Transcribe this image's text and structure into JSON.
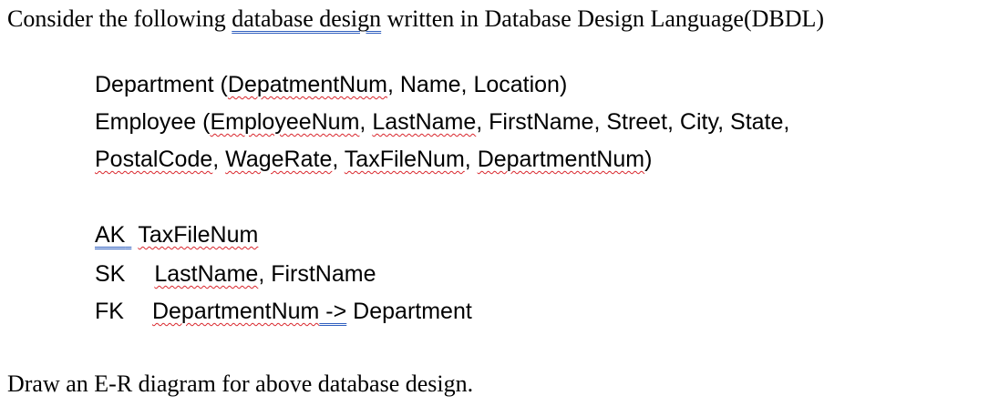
{
  "intro": {
    "before": "Consider the following ",
    "underlined": "database  design",
    "after": " written in Database Design Language(DBDL)"
  },
  "dept_line": {
    "label": "Department (",
    "key": "DepatmentNum",
    "rest": ", Name, Location)"
  },
  "emp_line1": {
    "label": "Employee (",
    "key": "EmployeeNum",
    "sep1": ", ",
    "lastname": "LastName",
    "rest": ", FirstName, Street, City, State,"
  },
  "emp_line2": {
    "postal": "PostalCode",
    "sep1": ", ",
    "wage": "WageRate",
    "sep2": ", ",
    "tax": "TaxFileNum",
    "sep3": ", ",
    "deptnum": "DepartmentNum",
    "close": ")"
  },
  "ak_line": {
    "code": "AK",
    "value": "TaxFileNum"
  },
  "sk_line": {
    "code": "SK",
    "value1": "LastName",
    "rest": ", FirstName"
  },
  "fk_line": {
    "code": "FK",
    "value": "DepartmentNum",
    "arrow": " ->",
    "target": " Department"
  },
  "question": "Draw an E-R diagram for above database design.",
  "colors": {
    "spell_underline": "#d9262c",
    "grammar_underline": "#2f5fbf"
  }
}
